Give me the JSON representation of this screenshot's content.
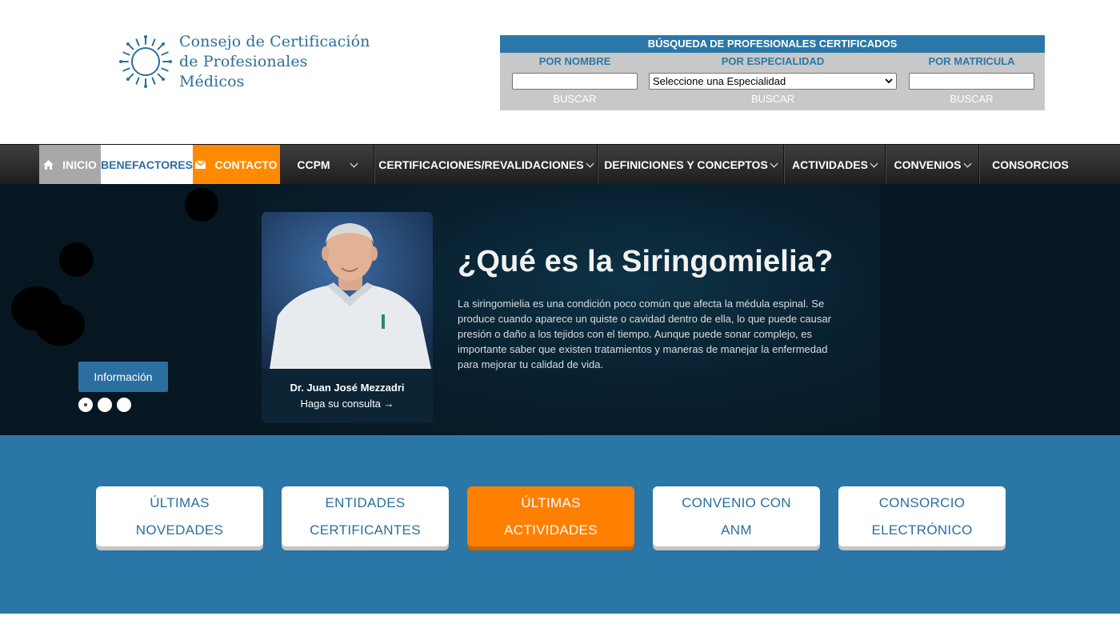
{
  "logo": {
    "line1": "Consejo de Certificación",
    "line2": "de Profesionales Médicos"
  },
  "search": {
    "title": "BÚSQUEDA DE PROFESIONALES CERTIFICADOS",
    "by_name_label": "POR NOMBRE",
    "by_specialty_label": "POR ESPECIALIDAD",
    "by_license_label": "POR MATRICULA",
    "specialty_selected": "Seleccione una Especialidad",
    "button_label": "BUSCAR"
  },
  "nav": {
    "inicio": "INICIO",
    "benefactores": "BENEFACTORES",
    "contacto": "CONTACTO",
    "ccpm": "CCPM",
    "certificaciones": "CERTIFICACIONES/REVALIDACIONES",
    "definiciones": "DEFINICIONES Y CONCEPTOS",
    "actividades": "ACTIVIDADES",
    "convenios": "CONVENIOS",
    "consorcios": "CONSORCIOS"
  },
  "hero": {
    "title": "¿Qué es la Siringomielia?",
    "body": "La siringomielia es una condición poco común que afecta la médula espinal. Se produce cuando aparece un quiste o cavidad dentro de ella, lo que puede causar presión o daño a los tejidos con el tiempo. Aunque puede sonar complejo, es importante saber que existen tratamientos y maneras de manejar la enfermedad para mejorar tu calidad de vida.",
    "doctor_name": "Dr. Juan José Mezzadri",
    "doctor_cta": "Haga su consulta →",
    "info_button": "Información",
    "slides_total": 3,
    "slide_active": 1
  },
  "tiles": [
    {
      "line1": "ÚLTIMAS",
      "line2": "NOVEDADES"
    },
    {
      "line1": "ENTIDADES",
      "line2": "CERTIFICANTES"
    },
    {
      "line1": "ÚLTIMAS",
      "line2": "ACTIVIDADES"
    },
    {
      "line1": "CONVENIO CON",
      "line2": "ANM"
    },
    {
      "line1": "CONSORCIO",
      "line2": "ELECTRÓNICO"
    }
  ],
  "colors": {
    "brand_blue": "#2b78a8",
    "accent_orange": "#ff7f00",
    "nav_dark": "#2a2a2a"
  }
}
